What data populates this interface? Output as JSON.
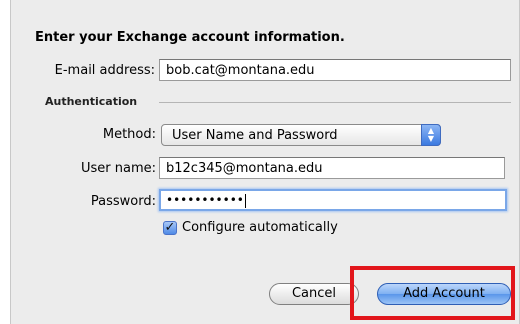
{
  "heading": "Enter your Exchange account information.",
  "email": {
    "label": "E-mail address:",
    "value": "bob.cat@montana.edu"
  },
  "authentication": {
    "section_title": "Authentication",
    "method_label": "Method:",
    "method_value": "User Name and Password",
    "username_label": "User name:",
    "username_value": "b12c345@montana.edu",
    "password_label": "Password:",
    "password_masked": "•••••••••••"
  },
  "configure": {
    "label": "Configure automatically",
    "checked": true
  },
  "buttons": {
    "cancel": "Cancel",
    "add_account": "Add Account"
  },
  "colors": {
    "highlight": "#e2161b",
    "focus_ring": "#7aa7e8",
    "default_button": "#5a96ea"
  }
}
